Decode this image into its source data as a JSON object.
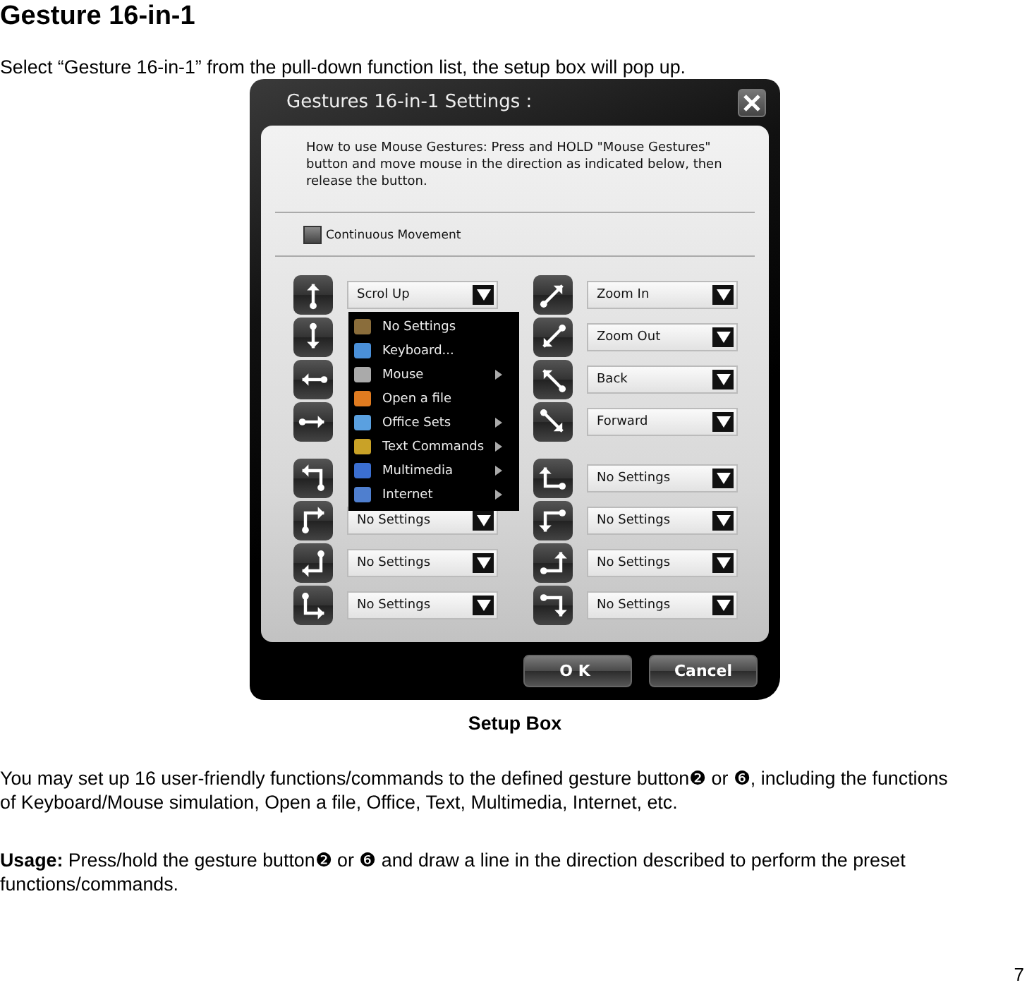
{
  "document": {
    "heading": "Gesture 16-in-1",
    "intro": "Select “Gesture 16-in-1” from the pull-down function list, the setup box will pop up.",
    "caption": "Setup Box",
    "paragraphs": [
      "You may set up 16 user-friendly functions/commands to the defined gesture button❷ or ❻, including the functions of Keyboard/Mouse simulation, Open a file, Office, Text, Multimedia, Internet, etc.",
      "**Usage:** Press/hold the gesture button❷ or ❻ and draw a line in the direction described to perform the preset functions/commands."
    ],
    "page_number": "7"
  },
  "dialog": {
    "title": "Gestures 16-in-1 Settings :",
    "instructions": "How to use Mouse Gestures: Press and HOLD \"Mouse Gestures\" button and move mouse in the direction as indicated below, then release the button.",
    "continuous_movement": {
      "label": "Continuous Movement",
      "checked": false
    },
    "gestures_left": [
      {
        "kind": "up",
        "value": "Scrol Up"
      },
      {
        "kind": "down"
      },
      {
        "kind": "left"
      },
      {
        "kind": "right"
      },
      {
        "kind": "up-then-left"
      },
      {
        "kind": "up-then-right",
        "value": "No Settings"
      },
      {
        "kind": "down-then-left",
        "value": "No Settings"
      },
      {
        "kind": "down-then-right",
        "value": "No Settings"
      }
    ],
    "gestures_right": [
      {
        "kind": "up-right",
        "value": "Zoom In"
      },
      {
        "kind": "down-left",
        "value": "Zoom Out"
      },
      {
        "kind": "up-left",
        "value": "Back"
      },
      {
        "kind": "down-right",
        "value": "Forward"
      },
      {
        "kind": "left-then-up",
        "value": "No Settings"
      },
      {
        "kind": "left-then-down",
        "value": "No Settings"
      },
      {
        "kind": "right-then-up",
        "value": "No Settings"
      },
      {
        "kind": "right-then-down",
        "value": "No Settings"
      }
    ],
    "menu": [
      {
        "label": "No Settings",
        "submenu": false
      },
      {
        "label": "Keyboard...",
        "submenu": false
      },
      {
        "label": "Mouse",
        "submenu": true
      },
      {
        "label": "Open a file",
        "submenu": false
      },
      {
        "label": "Office Sets",
        "submenu": true
      },
      {
        "label": "Text Commands",
        "submenu": true
      },
      {
        "label": "Multimedia",
        "submenu": true
      },
      {
        "label": "Internet",
        "submenu": true
      }
    ],
    "buttons": [
      "OK",
      "Cancel"
    ]
  }
}
